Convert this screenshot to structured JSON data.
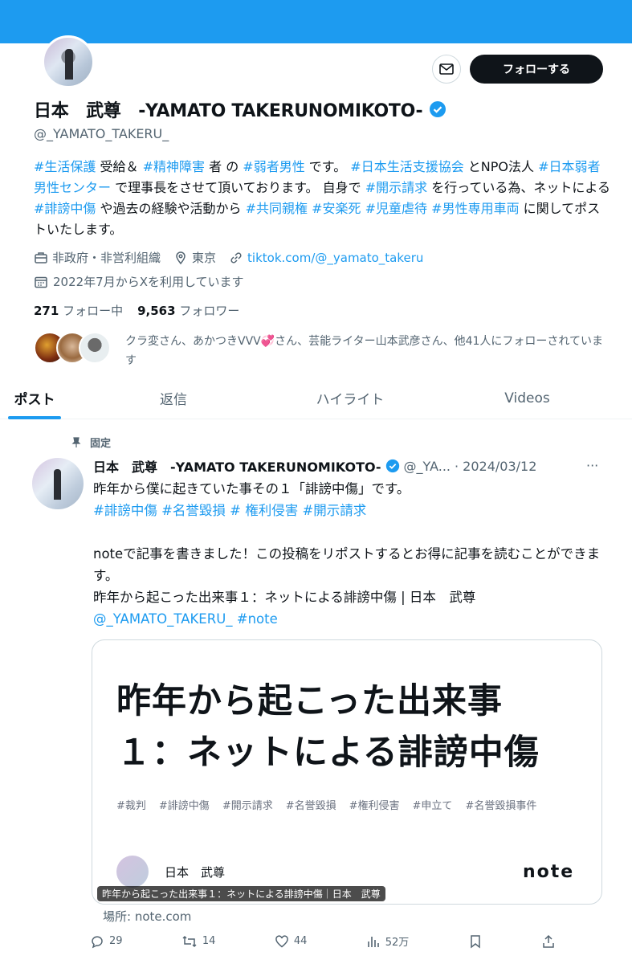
{
  "profile": {
    "name": "日本　武尊　-YAMATO TAKERUNOMIKOTO-",
    "handle": "@_YAMATO_TAKERU_",
    "follow_label": "フォローする",
    "bio": [
      {
        "t": "#生活保護",
        "tag": true
      },
      {
        "t": " 受給＆ ",
        "tag": false
      },
      {
        "t": "#精神障害",
        "tag": true
      },
      {
        "t": " 者 の ",
        "tag": false
      },
      {
        "t": "#弱者男性",
        "tag": true
      },
      {
        "t": " です。 ",
        "tag": false
      },
      {
        "t": "#日本生活支援協会",
        "tag": true
      },
      {
        "t": " とNPO法人 ",
        "tag": false
      },
      {
        "t": "#日本弱者男性センター",
        "tag": true
      },
      {
        "t": " で理事長をさせて頂いております。 自身で ",
        "tag": false
      },
      {
        "t": "#開示請求",
        "tag": true
      },
      {
        "t": " を行っている為、ネットによる ",
        "tag": false
      },
      {
        "t": "#誹謗中傷",
        "tag": true
      },
      {
        "t": " や過去の経験や活動から ",
        "tag": false
      },
      {
        "t": "#共同親権",
        "tag": true
      },
      {
        "t": " ",
        "tag": false
      },
      {
        "t": "#安楽死",
        "tag": true
      },
      {
        "t": " ",
        "tag": false
      },
      {
        "t": "#児童虐待",
        "tag": true
      },
      {
        "t": " ",
        "tag": false
      },
      {
        "t": "#男性専用車両",
        "tag": true
      },
      {
        "t": " に関してポストいたします。",
        "tag": false
      }
    ],
    "category": "非政府・非営利組織",
    "location": "東京",
    "website": "tiktok.com/@_yamato_takeru",
    "joined": "2022年7月からXを利用しています",
    "following_count": "271",
    "following_label": "フォロー中",
    "followers_count": "9,563",
    "followers_label": "フォロワー",
    "followed_by": "クラ変さん、あかつきVVV💞さん、芸能ライター山本武彦さん、他41人にフォローされています"
  },
  "tabs": [
    "ポスト",
    "返信",
    "ハイライト",
    "Videos"
  ],
  "post": {
    "pinned_label": "固定",
    "name": "日本　武尊　-YAMATO TAKERUNOMIKOTO-",
    "handle": "@_YA...",
    "date": "· 2024/03/12",
    "line1": "昨年から僕に起きていた事その１「誹謗中傷」です。",
    "tags": "#誹謗中傷 #名誉毀損 # 権利侵害 #開示請求",
    "line2": "noteで記事を書きました！この投稿をリポストするとお得に記事を読むことができます。",
    "line3": "昨年から起こった出来事１：ネットによる誹謗中傷 | 日本　武尊",
    "line4": "@_YAMATO_TAKERU_ #note",
    "card": {
      "title_line1": "昨年から起こった出来事",
      "title_line2": "１：ネットによる誹謗中傷",
      "tags": [
        "#裁判",
        "#誹謗中傷",
        "#開示請求",
        "#名誉毀損",
        "#権利侵害",
        "#申立て",
        "#名誉毀損事件"
      ],
      "author": "日本　武尊",
      "logo": "note",
      "overlay": "昨年から起こった出来事１：ネットによる誹謗中傷｜日本　武尊",
      "source": "場所: note.com"
    },
    "stats": {
      "replies": "29",
      "reposts": "14",
      "likes": "44",
      "views": "52万"
    }
  },
  "colors": {
    "accent": "#1d9bf0",
    "text": "#0f1419",
    "muted": "#536471"
  }
}
